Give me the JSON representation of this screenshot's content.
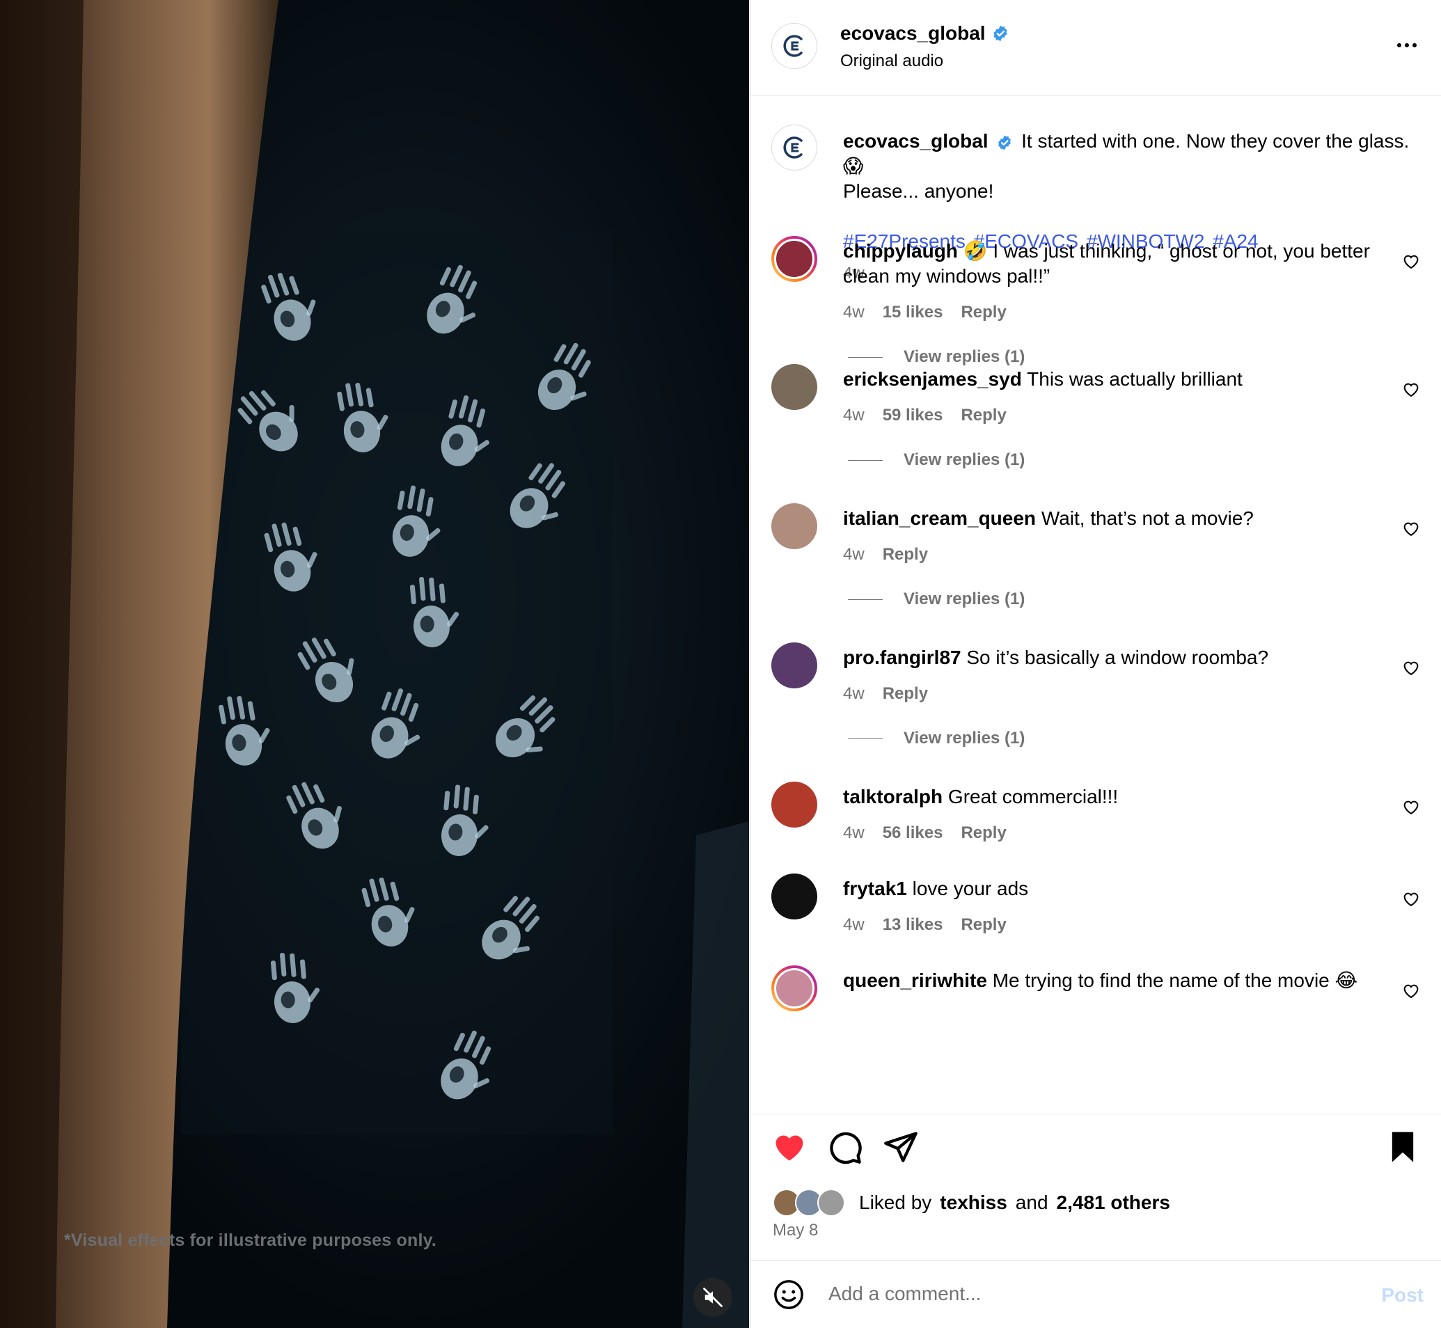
{
  "media": {
    "disclaimer": "*Visual effects for illustrative purposes only.",
    "mute_icon": "speaker-muted-icon"
  },
  "header": {
    "username": "ecovacs_global",
    "subtitle": "Original audio",
    "verified": true,
    "more_icon": "more-horizontal-icon"
  },
  "caption": {
    "username": "ecovacs_global",
    "text_line1": "It started with one. Now they cover the glass. 😱",
    "text_line2": "Please... anyone!",
    "hashtags": [
      "#E27Presents",
      "#ECOVACS",
      "#WINBOTW2",
      "#A24"
    ],
    "time": "4w"
  },
  "comments": [
    {
      "username": "chippylaugh",
      "text": "🤣 I was just thinking, “ ghost or not, you better clean my windows pal!!”",
      "time": "4w",
      "likes": "15 likes",
      "reply": "Reply",
      "view_replies": "View replies (1)",
      "avatar_color": "#8a2a3a"
    },
    {
      "username": "ericksenjames_syd",
      "text": "This was actually brilliant",
      "time": "4w",
      "likes": "59 likes",
      "reply": "Reply",
      "view_replies": "View replies (1)",
      "avatar_color": "#7a6a5a"
    },
    {
      "username": "italian_cream_queen",
      "text": "Wait, that’s not a movie?",
      "time": "4w",
      "likes": "",
      "reply": "Reply",
      "view_replies": "View replies (1)",
      "avatar_color": "#b08c7c"
    },
    {
      "username": "pro.fangirl87",
      "text": "So it’s basically a window roomba?",
      "time": "4w",
      "likes": "",
      "reply": "Reply",
      "view_replies": "View replies (1)",
      "avatar_color": "#5a3a6a"
    },
    {
      "username": "talktoralph",
      "text": "Great commercial!!!",
      "time": "4w",
      "likes": "56 likes",
      "reply": "Reply",
      "view_replies": "",
      "avatar_color": "#b23a2a"
    },
    {
      "username": "frytak1",
      "text": "love your ads",
      "time": "4w",
      "likes": "13 likes",
      "reply": "Reply",
      "view_replies": "",
      "avatar_color": "#111111"
    },
    {
      "username": "queen_ririwhite",
      "text": "Me trying to find the name of the movie 😂",
      "time": "",
      "likes": "",
      "reply": "",
      "view_replies": "",
      "avatar_color": "#c88a9a"
    }
  ],
  "actions": {
    "like_icon": "heart-filled-icon",
    "comment_icon": "comment-bubble-icon",
    "share_icon": "paper-plane-icon",
    "save_icon": "bookmark-filled-icon",
    "like_color": "#ff3040"
  },
  "likes": {
    "prefix": "Liked by",
    "user": "texhiss",
    "and": "and",
    "others": "2,481 others"
  },
  "date": "May 8",
  "comment_box": {
    "placeholder": "Add a comment...",
    "post_label": "Post",
    "emoji_icon": "smiley-icon"
  },
  "colors": {
    "link_blue": "#3d5ae0",
    "muted_text": "#737373",
    "post_disabled": "#c5dcfa",
    "verified_blue": "#3897f0"
  }
}
